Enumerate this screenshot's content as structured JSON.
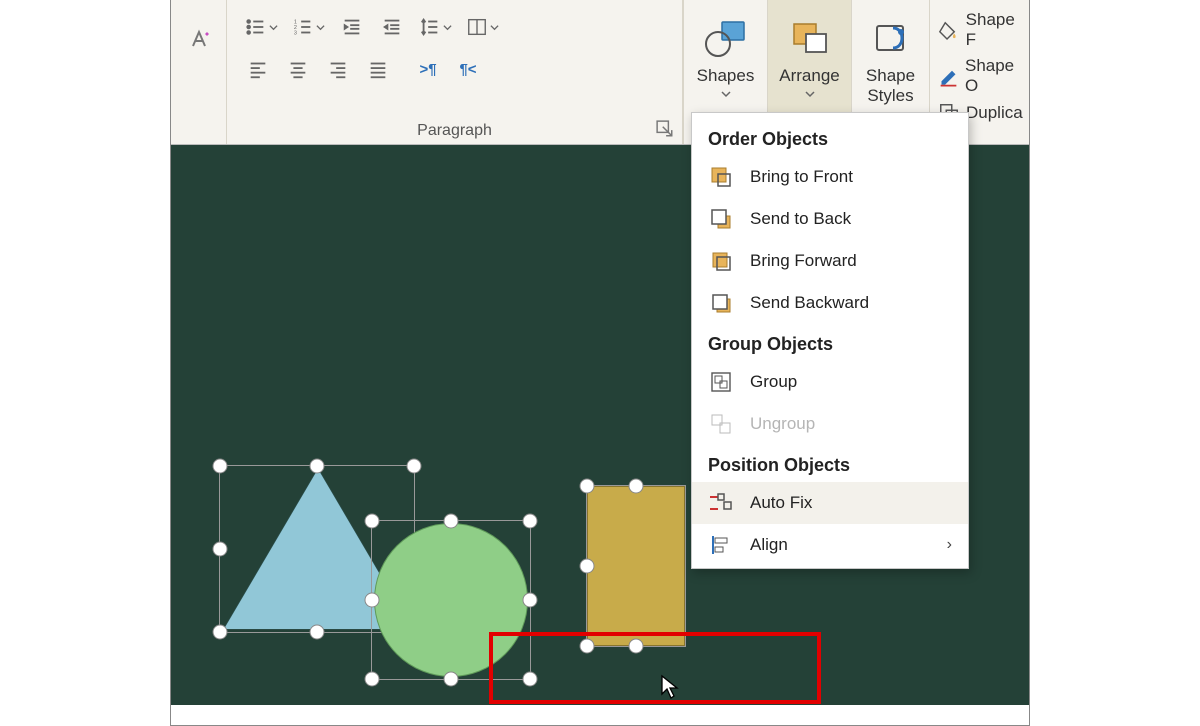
{
  "ribbon": {
    "paragraph_label": "Paragraph",
    "shapes_label": "Shapes",
    "arrange_label": "Arrange",
    "shape_styles_label": "Shape\nStyles",
    "extra": {
      "shape_f": "Shape F",
      "shape_o": "Shape O",
      "duplica": "Duplica"
    }
  },
  "menu": {
    "order_title": "Order Objects",
    "bring_front": "Bring to Front",
    "send_back": "Send to Back",
    "bring_forward": "Bring Forward",
    "send_backward": "Send Backward",
    "group_title": "Group Objects",
    "group": "Group",
    "ungroup": "Ungroup",
    "position_title": "Position Objects",
    "auto_fix": "Auto Fix",
    "align": "Align"
  },
  "colors": {
    "canvas": "#244137",
    "triangle": "#91c7d7",
    "circle": "#8fce87",
    "rect": "#c8ab4a",
    "highlight": "#e20000"
  }
}
